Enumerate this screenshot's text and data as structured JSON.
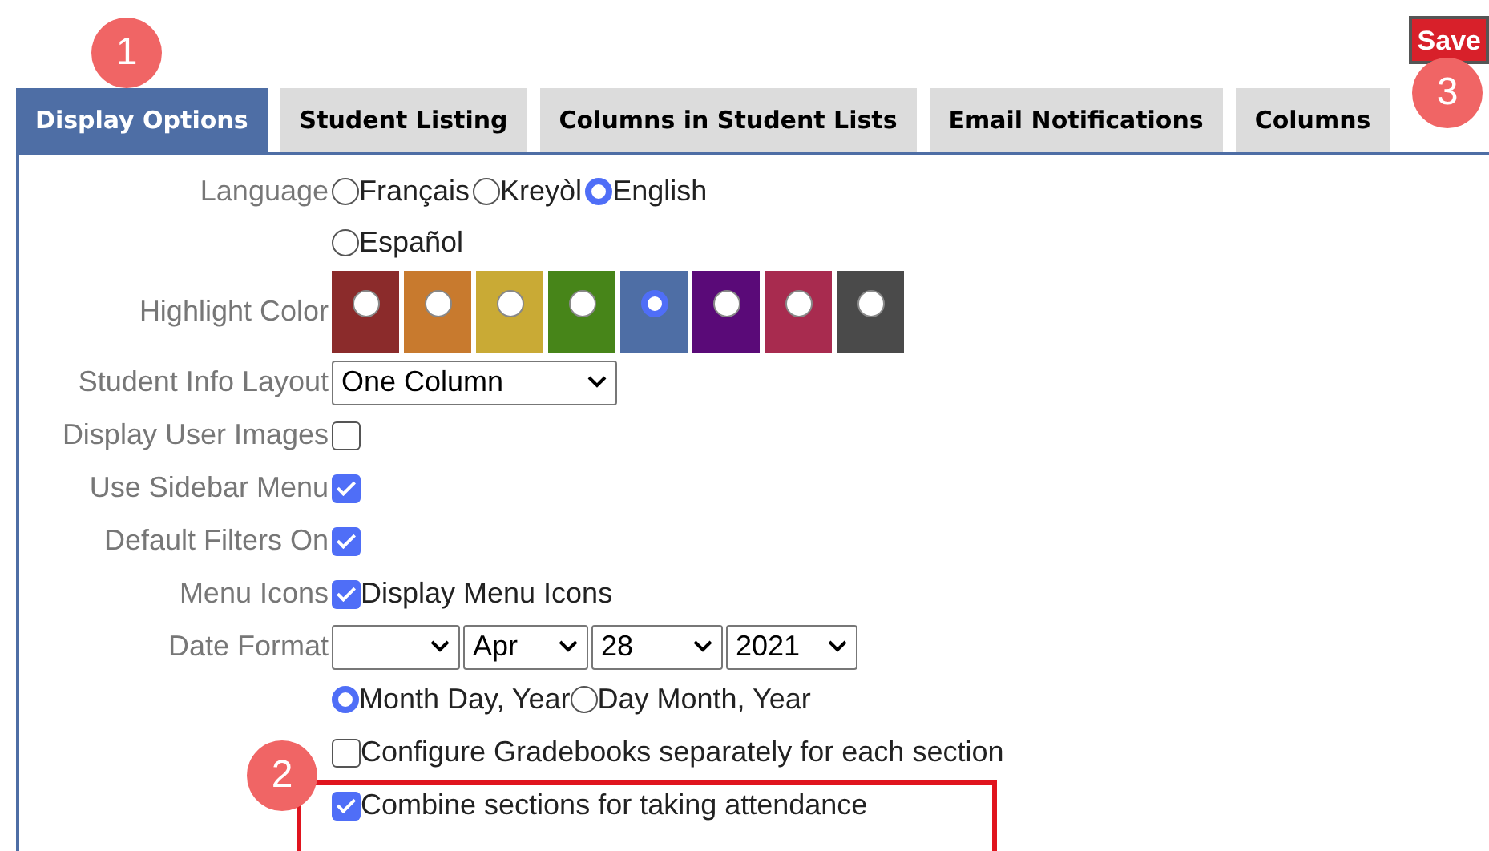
{
  "save_button": "Save",
  "tabs": [
    {
      "label": "Display Options",
      "selected": true
    },
    {
      "label": "Student Listing",
      "selected": false
    },
    {
      "label": "Columns in Student Lists",
      "selected": false
    },
    {
      "label": "Email Notifications",
      "selected": false
    },
    {
      "label": "Columns",
      "selected": false
    }
  ],
  "language": {
    "label": "Language",
    "options": [
      {
        "label": "Français",
        "selected": false
      },
      {
        "label": "Kreyòl",
        "selected": false
      },
      {
        "label": "English",
        "selected": true
      },
      {
        "label": "Español",
        "selected": false
      }
    ]
  },
  "highlight": {
    "label": "Highlight Color",
    "swatches": [
      {
        "color": "#8b2b2b",
        "selected": false
      },
      {
        "color": "#c87a2e",
        "selected": false
      },
      {
        "color": "#c9aa35",
        "selected": false
      },
      {
        "color": "#478519",
        "selected": false
      },
      {
        "color": "#4e6ea5",
        "selected": true
      },
      {
        "color": "#5a0a78",
        "selected": false
      },
      {
        "color": "#a82b4f",
        "selected": false
      },
      {
        "color": "#4a4a4a",
        "selected": false
      }
    ]
  },
  "student_info_layout": {
    "label": "Student Info Layout",
    "value": "One Column"
  },
  "checks": [
    {
      "label": "Display User Images",
      "checked": false
    },
    {
      "label": "Use Sidebar Menu",
      "checked": true
    },
    {
      "label": "Default Filters On",
      "checked": true
    },
    {
      "label": "Menu Icons",
      "checked": true,
      "text": "Display Menu Icons"
    }
  ],
  "date_format": {
    "label": "Date Format",
    "selects": [
      {
        "kind": "blank"
      },
      {
        "kind": "value",
        "value": "Apr"
      },
      {
        "kind": "value",
        "value": "28"
      },
      {
        "kind": "value",
        "value": "2021"
      }
    ],
    "order": [
      {
        "label": "Month Day, Year",
        "selected": true
      },
      {
        "label": "Day Month, Year",
        "selected": false
      }
    ]
  },
  "options": [
    {
      "label": "Configure Gradebooks separately for each section",
      "checked": false
    },
    {
      "label": "Combine sections for taking attendance",
      "checked": true
    }
  ],
  "callouts": [
    "1",
    "2",
    "3"
  ]
}
